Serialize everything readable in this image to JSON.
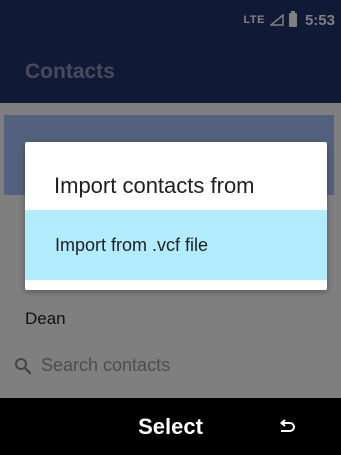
{
  "status_bar": {
    "network": "LTE",
    "time": "5:53",
    "signal_icon": "signal-icon",
    "battery_icon": "battery-icon"
  },
  "app_bar": {
    "title": "Contacts"
  },
  "content": {
    "contact_name": "Dean",
    "search": {
      "placeholder": "Search contacts",
      "icon": "search-icon"
    }
  },
  "dialog": {
    "title": "Import contacts from",
    "options": [
      {
        "label": "Import from .vcf file",
        "selected": true
      }
    ]
  },
  "softkeys": {
    "center": "Select",
    "right_icon": "back-icon"
  },
  "colors": {
    "app_bar": "#21346f",
    "selection": "#b3ecfe",
    "highlight_strip": "#a6c2ff"
  }
}
